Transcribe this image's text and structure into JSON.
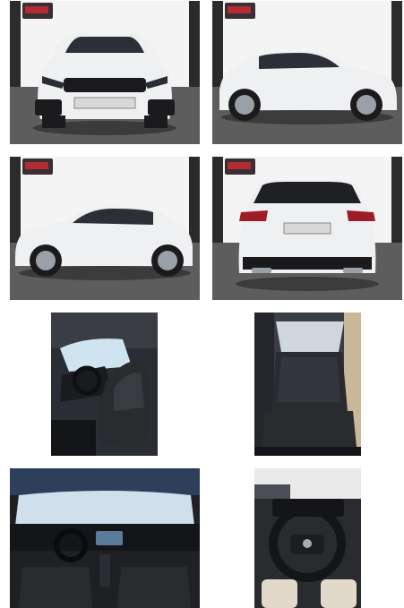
{
  "gallery": {
    "photos": [
      {
        "alt": "",
        "icon": "car-front-photo"
      },
      {
        "alt": "",
        "icon": "car-side-right-photo"
      },
      {
        "alt": "",
        "icon": "car-side-left-photo"
      },
      {
        "alt": "",
        "icon": "car-rear-photo"
      },
      {
        "alt": "",
        "icon": "front-seats-photo"
      },
      {
        "alt": "",
        "icon": "rear-seats-photo"
      },
      {
        "alt": "",
        "icon": "dashboard-photo"
      },
      {
        "alt": "",
        "icon": "steering-wheel-photo"
      }
    ]
  },
  "colors": {
    "car_white": "#eef0f2",
    "showroom_floor": "#5d5d5e",
    "showroom_wall": "#f4f4f4",
    "pillar": "#2b2b2b",
    "interior_dark": "#1f2024",
    "seat_black": "#2a2b2f"
  }
}
